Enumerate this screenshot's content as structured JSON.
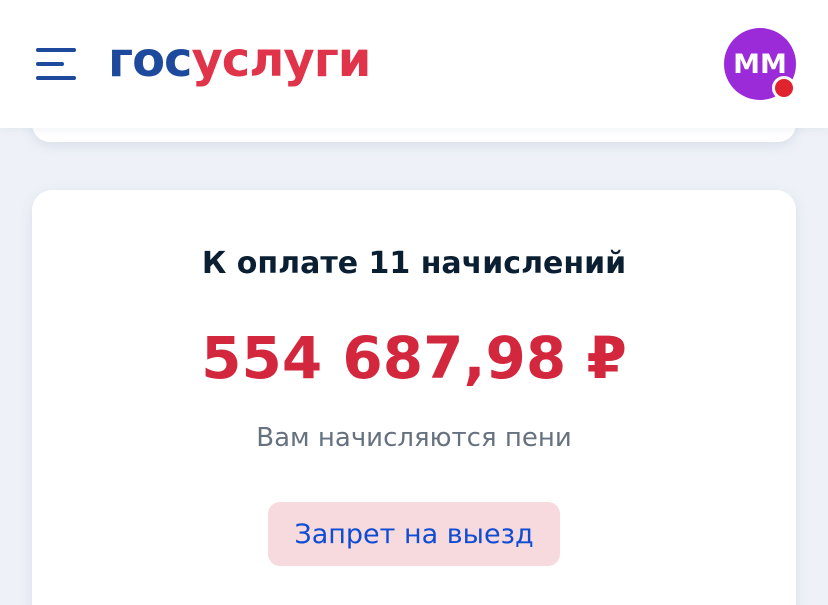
{
  "header": {
    "menu_icon": "hamburger-menu-icon",
    "logo": {
      "part1": "гос",
      "part2": "услуги",
      "colors": {
        "part1": "#1e4a9e",
        "part2": "#e0344b"
      }
    },
    "avatar": {
      "initials": "ММ",
      "color": "#9b2ad8",
      "notification_color": "#e0232f"
    }
  },
  "charges": {
    "title": "К оплате 11 начислений",
    "amount": "554 687,98 ₽",
    "amount_color": "#d3273e",
    "note": "Вам начисляются пени",
    "restriction": {
      "label": "Запрет на выезд",
      "background": "#f7dadd",
      "text_color": "#0d4cd3"
    }
  }
}
